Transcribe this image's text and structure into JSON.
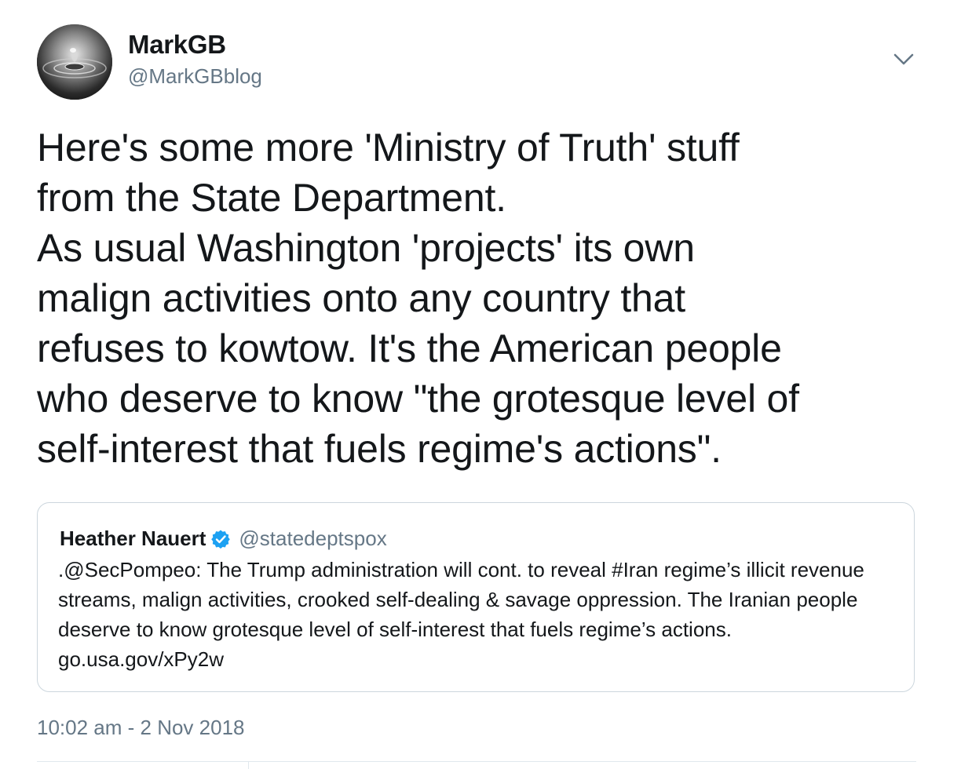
{
  "author": {
    "display_name": "MarkGB",
    "handle": "@MarkGBblog",
    "avatar_icon": "water-drop-avatar"
  },
  "tweet": {
    "text": "Here's some more 'Ministry of Truth' stuff\nfrom the State Department.\nAs usual Washington 'projects' its own\nmalign activities onto any country that\nrefuses to kowtow. It's the American people\nwho deserve to know \"the grotesque level of\nself-interest that fuels regime's actions\".",
    "timestamp": "10:02 am - 2 Nov 2018"
  },
  "quoted_tweet": {
    "display_name": "Heather Nauert",
    "handle": "@statedeptspox",
    "verified": true,
    "text": ".@SecPompeo: The Trump administration will cont. to reveal #Iran regime’s illicit revenue streams, malign activities, crooked self-dealing & savage oppression. The Iranian people deserve to know grotesque level of self-interest that fuels regime’s actions. go.usa.gov/xPy2w"
  },
  "icons": {
    "caret": "chevron-down-icon",
    "verified": "verified-badge-icon"
  },
  "colors": {
    "text_primary": "#14171a",
    "text_secondary": "#657786",
    "verified_blue": "#1da1f2",
    "border": "#ccd6dd"
  }
}
